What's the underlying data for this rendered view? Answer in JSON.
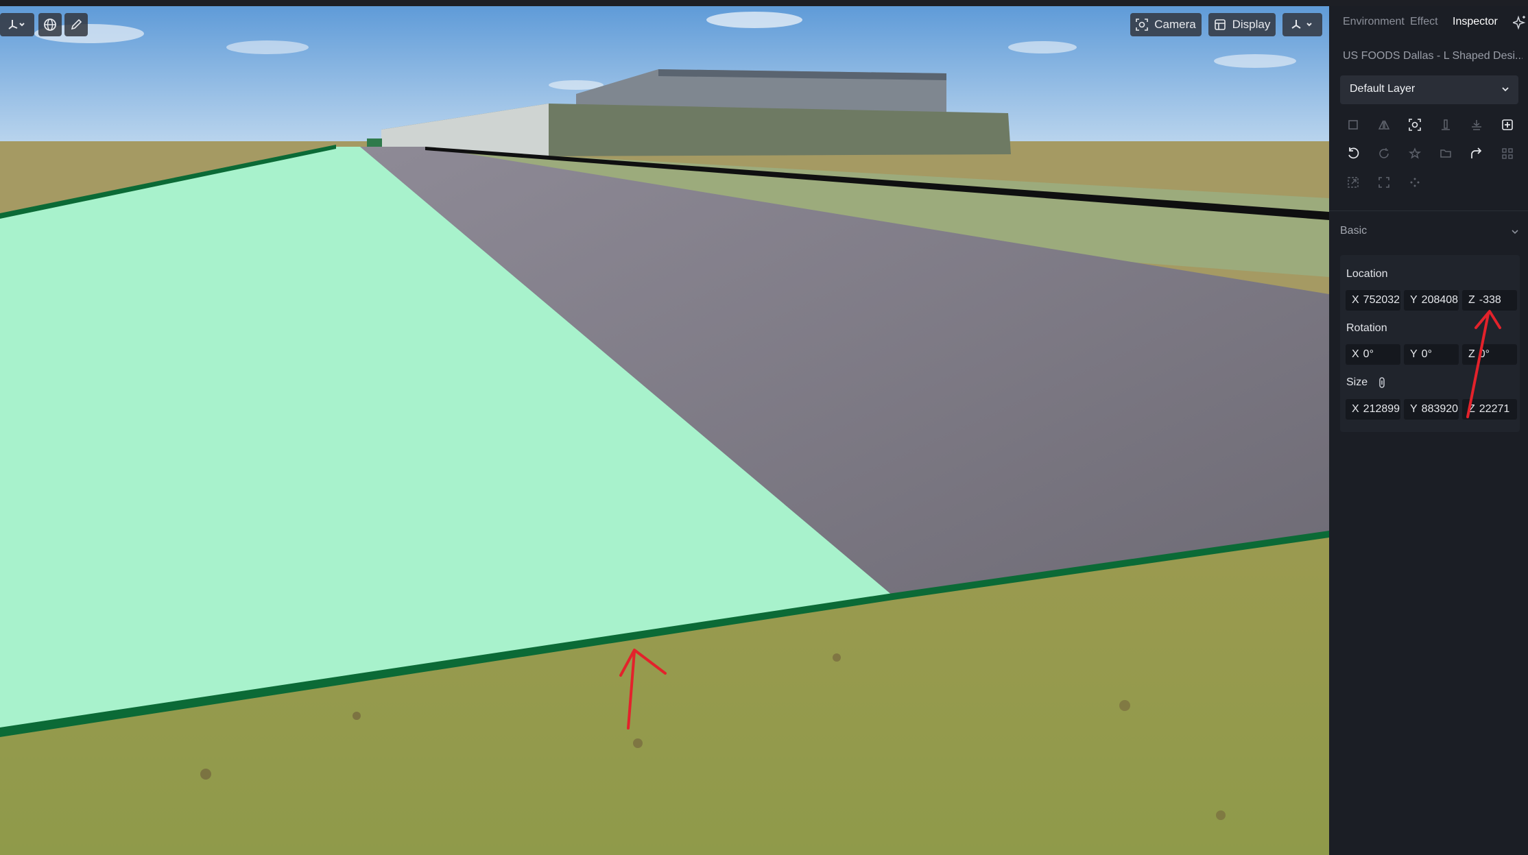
{
  "toolbar_left": {
    "buttons": [
      {
        "name": "transform-menu",
        "icon": "gizmo-icon"
      },
      {
        "name": "globe",
        "icon": "globe-icon"
      },
      {
        "name": "measure",
        "icon": "pen-icon"
      }
    ]
  },
  "toolbar_right": {
    "camera_label": "Camera",
    "display_label": "Display"
  },
  "panel": {
    "tabs": [
      {
        "label": "Environment",
        "active": false
      },
      {
        "label": "Effect",
        "active": false
      },
      {
        "label": "Inspector",
        "active": true
      }
    ],
    "document_title": "US FOODS Dallas - L Shaped Desi...",
    "layer": {
      "selected": "Default Layer"
    },
    "tool_icons": [
      [
        "box-icon",
        "mirror-icon",
        "focus-icon",
        "align-icon",
        "stack-icon",
        "add-icon"
      ],
      [
        "undo-icon",
        "refresh-icon",
        "star-icon",
        "folder-icon",
        "redo-icon",
        "grid-icon"
      ],
      [
        "scale-icon",
        "expand-icon",
        "dots-icon"
      ]
    ],
    "section": "Basic",
    "location": {
      "label": "Location",
      "x": "752032",
      "y": "208408",
      "z": "-338"
    },
    "rotation": {
      "label": "Rotation",
      "x": "0°",
      "y": "0°",
      "z": "0°"
    },
    "size": {
      "label": "Size",
      "x": "212899",
      "y": "883920",
      "z": "22271"
    },
    "axis_labels": {
      "x": "X",
      "y": "Y",
      "z": "Z"
    }
  },
  "colors": {
    "panel_bg": "#1b1e25",
    "field_bg": "#15181e",
    "accent_green": "#a8f2cc",
    "annotation_red": "#e3222b"
  }
}
